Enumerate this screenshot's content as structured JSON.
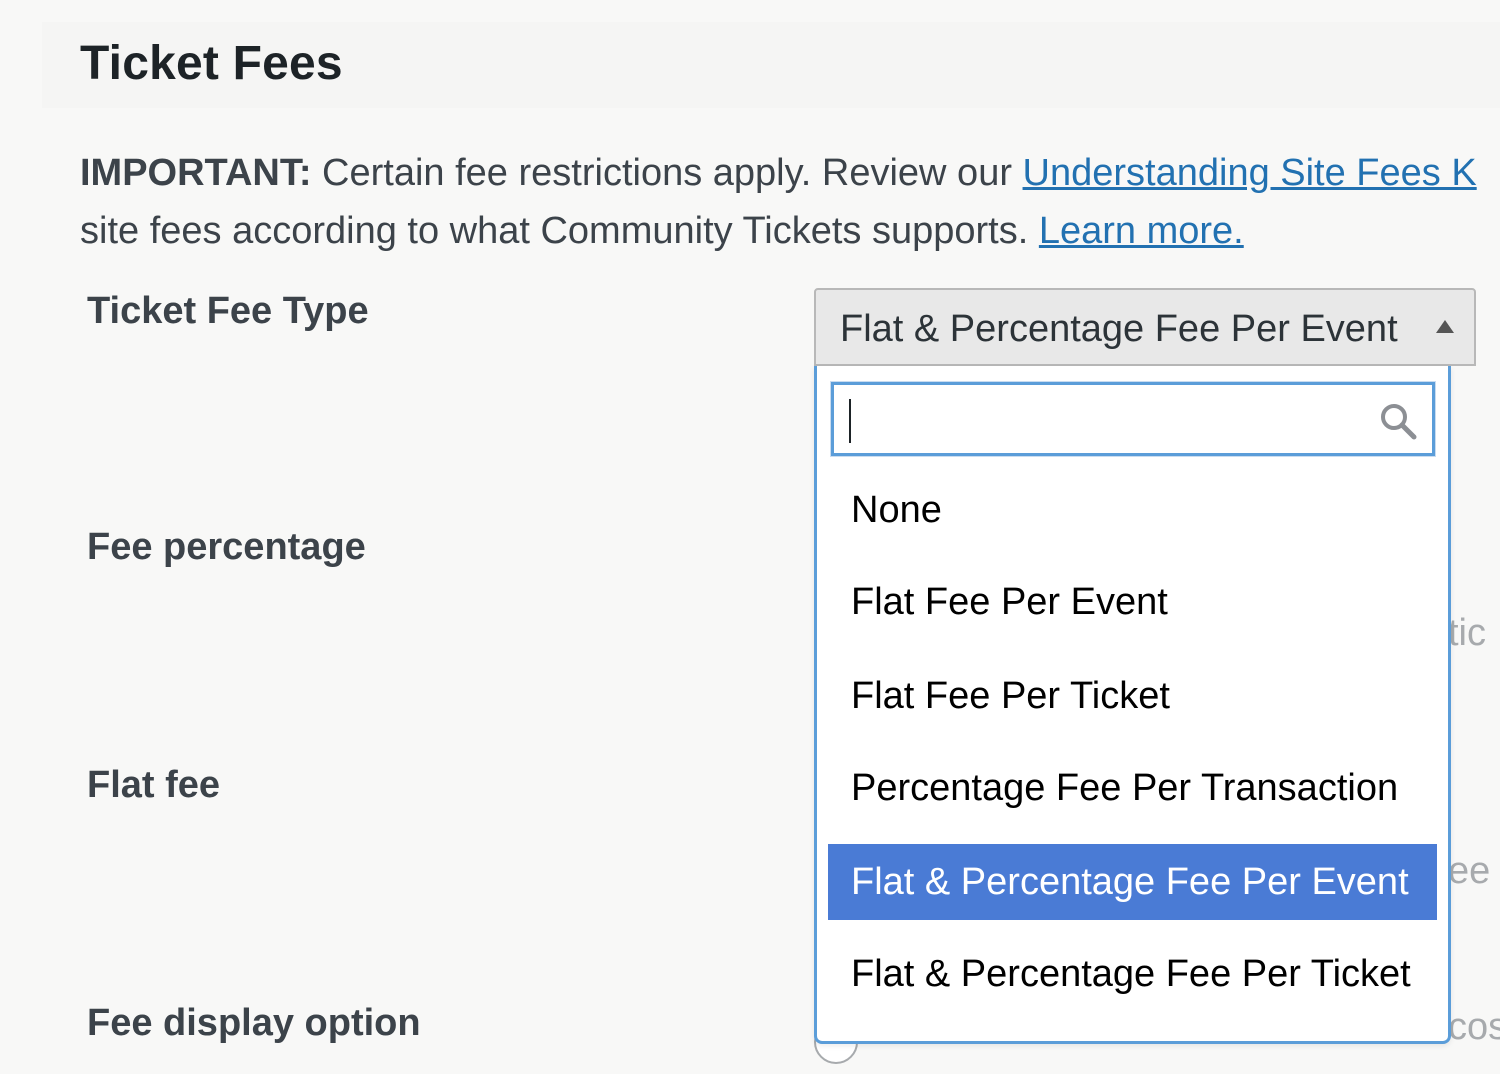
{
  "section": {
    "title": "Ticket Fees"
  },
  "notice": {
    "important_label": "IMPORTANT:",
    "text_before_link": " Certain fee restrictions apply. Review our ",
    "link_text": "Understanding Site Fees K",
    "line2_text": "site fees according to what Community Tickets supports. ",
    "learn_more": "Learn more."
  },
  "fields": {
    "ticket_fee_type": "Ticket Fee Type",
    "fee_percentage": "Fee percentage",
    "flat_fee": "Flat fee",
    "fee_display_option": "Fee display option"
  },
  "background_hints": {
    "hint1": "tic",
    "hint2": "ee",
    "hint3": "cos"
  },
  "select": {
    "selected_value": "Flat & Percentage Fee Per Event",
    "search_value": "",
    "options": [
      "None",
      "Flat Fee Per Event",
      "Flat Fee Per Ticket",
      "Percentage Fee Per Transaction",
      "Flat & Percentage Fee Per Event",
      "Flat & Percentage Fee Per Ticket"
    ],
    "highlighted_index": 4
  },
  "colors": {
    "link": "#2271b1",
    "focus_border": "#5b9dd9",
    "highlight_bg": "#4a7bd5",
    "page_bg": "#f8f8f7"
  }
}
